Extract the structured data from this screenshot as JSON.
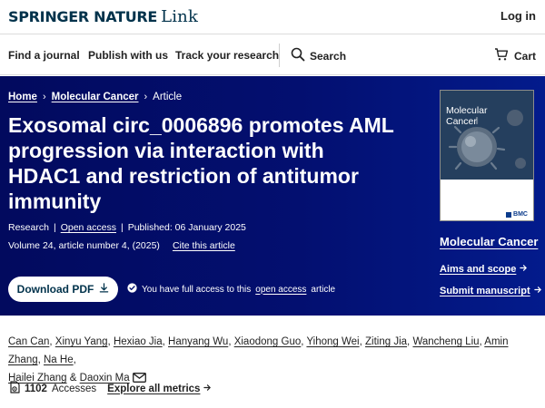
{
  "brand": {
    "name_bold": "SPRINGER NATURE",
    "name_link": "Link"
  },
  "header": {
    "login_label": "Log in"
  },
  "nav": {
    "items": [
      "Find a journal",
      "Publish with us",
      "Track your research"
    ],
    "search_label": "Search",
    "cart_label": "Cart"
  },
  "breadcrumb": {
    "home": "Home",
    "journal": "Molecular Cancer",
    "current": "Article"
  },
  "article": {
    "title": "Exosomal circ_0006896 promotes AML progression via interaction with HDAC1 and restriction of antitumor immunity",
    "type": "Research",
    "access": "Open access",
    "published": "Published: 06 January 2025",
    "volume_info": "Volume 24, article number 4, (2025)",
    "cite_label": "Cite this article"
  },
  "download": {
    "label": "Download PDF"
  },
  "access_note": {
    "prefix": "You have full access to this",
    "link": "open access",
    "suffix": "article"
  },
  "journal": {
    "cover_title": "Molecular Cancer",
    "cover_publisher": "BMC",
    "name": "Molecular Cancer",
    "aims_label": "Aims and scope",
    "submit_label": "Submit manuscript"
  },
  "authors": [
    "Can Can",
    "Xinyu Yang",
    "Hexiao Jia",
    "Hanyang Wu",
    "Xiaodong Guo",
    "Yihong Wei",
    "Ziting Jia",
    "Wancheng Liu",
    "Amin Zhang",
    "Na He",
    "Hailei Zhang",
    "Daoxin Ma"
  ],
  "authors_conjunction": "&",
  "metrics": {
    "accesses_count": "1102",
    "accesses_label": "Accesses",
    "explore_label": "Explore all metrics"
  }
}
